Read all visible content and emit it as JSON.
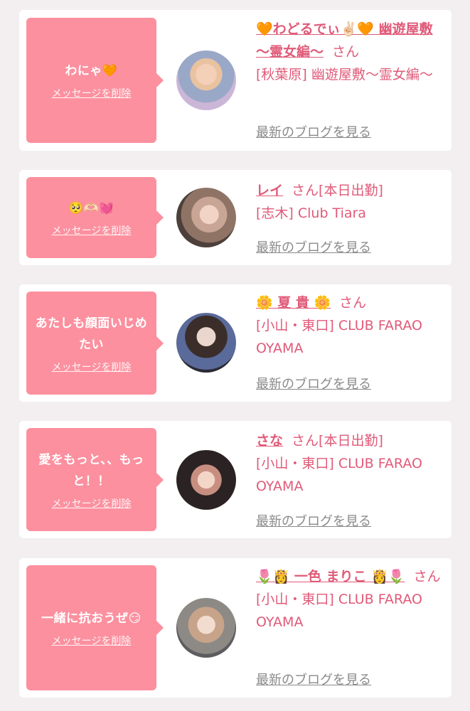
{
  "cards": [
    {
      "message": "わにゃ🧡",
      "delete_label": "メッセージを削除",
      "name": "🧡わどるでぃ✌🏻🧡 幽遊屋敷 〜霊女編〜",
      "suffix": "さん",
      "status": "",
      "shop": "[秋葉原] 幽遊屋敷〜霊女編〜",
      "blog_label": "最新のブログを見る"
    },
    {
      "message": "🥺🫶🏻💓",
      "delete_label": "メッセージを削除",
      "name": "レイ",
      "suffix": "さん",
      "status": "[本日出勤]",
      "shop": "[志木] Club Tiara",
      "blog_label": "最新のブログを見る"
    },
    {
      "message": "あたしも顔面いじめたい",
      "delete_label": "メッセージを削除",
      "name": "🌼 夏 貴 🌼",
      "suffix": "さん",
      "status": "",
      "shop": "[小山・東口] CLUB FARAO OYAMA",
      "blog_label": "最新のブログを見る"
    },
    {
      "message": "愛をもっと、、もっと！！",
      "delete_label": "メッセージを削除",
      "name": "さな",
      "suffix": "さん",
      "status": "[本日出勤]",
      "shop": "[小山・東口] CLUB FARAO OYAMA",
      "blog_label": "最新のブログを見る"
    },
    {
      "message": "一緒に抗おうぜ😏",
      "delete_label": "メッセージを削除",
      "name": "🌷👸 一色 まりこ 👸🌷",
      "suffix": "さん",
      "status": "",
      "shop": "[小山・東口] CLUB FARAO OYAMA",
      "blog_label": "最新のブログを見る"
    }
  ],
  "colors": {
    "bubble": "#fc909f",
    "accent": "#e05a78",
    "link_gray": "#8a8a8a",
    "page_bg": "#f3eff1"
  }
}
